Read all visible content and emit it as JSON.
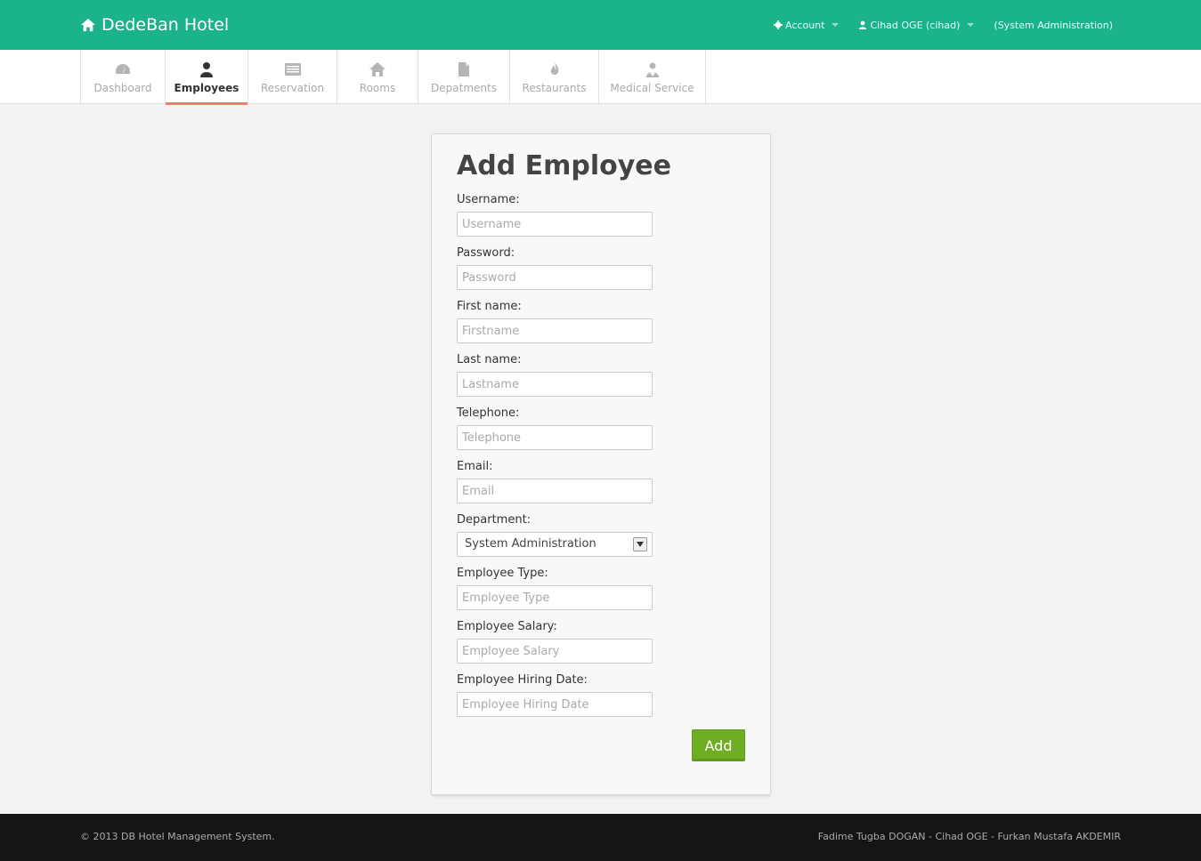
{
  "brand": {
    "title": "DedeBan Hotel",
    "icon": "home-icon"
  },
  "topnav": {
    "account": "Account",
    "user": "Cihad OGE (cihad)",
    "role": "(System Administration)"
  },
  "tabs": [
    {
      "label": "Dashboard",
      "icon": "dashboard-icon"
    },
    {
      "label": "Employees",
      "icon": "user-icon"
    },
    {
      "label": "Reservation",
      "icon": "list-icon"
    },
    {
      "label": "Rooms",
      "icon": "home-icon"
    },
    {
      "label": "Depatments",
      "icon": "file-icon"
    },
    {
      "label": "Restaurants",
      "icon": "fire-icon"
    },
    {
      "label": "Medical Service",
      "icon": "doctor-icon"
    }
  ],
  "form": {
    "title": "Add Employee",
    "fields": [
      {
        "label": "Username:",
        "placeholder": "Username"
      },
      {
        "label": "Password:",
        "placeholder": "Password"
      },
      {
        "label": "First name:",
        "placeholder": "Firstname"
      },
      {
        "label": "Last name:",
        "placeholder": "Lastname"
      },
      {
        "label": "Telephone:",
        "placeholder": "Telephone"
      },
      {
        "label": "Email:",
        "placeholder": "Email"
      },
      {
        "label": "Department:",
        "value": "System Administration"
      },
      {
        "label": "Employee Type:",
        "placeholder": "Employee Type"
      },
      {
        "label": "Employee Salary:",
        "placeholder": "Employee Salary"
      },
      {
        "label": "Employee Hiring Date:",
        "placeholder": "Employee Hiring Date"
      }
    ],
    "submit": "Add"
  },
  "footer": {
    "copyright": "© 2013 DB Hotel Management System.",
    "authors": "Fadime Tugba DOGAN - Cihad OGE - Furkan Mustafa AKDEMIR"
  },
  "colors": {
    "topbar": "#1bb38a",
    "accent": "#f07a6b",
    "button": "#6fae22"
  }
}
